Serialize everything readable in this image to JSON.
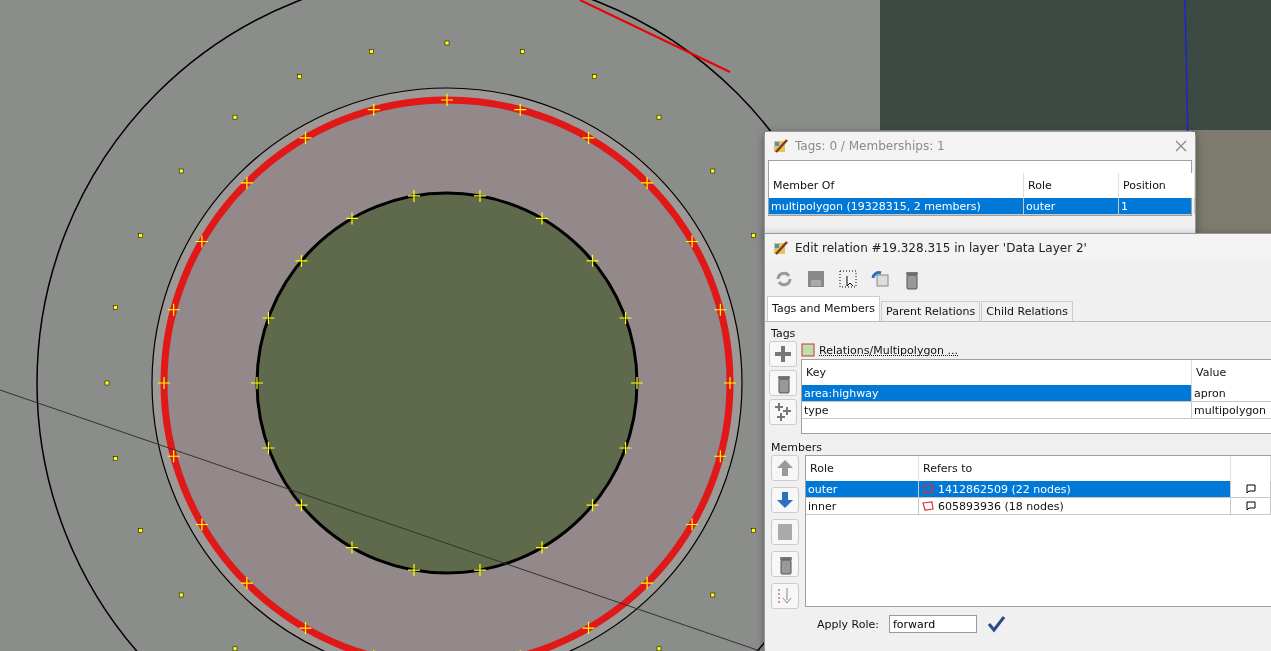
{
  "tags_dialog": {
    "title": "Tags: 0 / Memberships: 1",
    "columns": [
      "Member Of",
      "Role",
      "Position"
    ],
    "rows": [
      {
        "cells": [
          "multipolygon (19328315, 2 members)",
          "outer",
          "1"
        ],
        "selected": true
      }
    ]
  },
  "relation_editor": {
    "title": "Edit relation #19.328.315 in layer 'Data Layer 2'",
    "tabs": [
      {
        "label": "Tags and Members",
        "selected": true
      },
      {
        "label": "Parent Relations",
        "selected": false
      },
      {
        "label": "Child Relations",
        "selected": false
      }
    ],
    "tags_label": "Tags",
    "preset_link": "Relations/Multipolygon ...",
    "tag_columns": [
      "Key",
      "Value"
    ],
    "tags": [
      {
        "key": "area:highway",
        "value": "apron",
        "selected": true
      },
      {
        "key": "type",
        "value": "multipolygon",
        "selected": false
      }
    ],
    "members_label": "Members",
    "member_columns": [
      "Role",
      "Refers to"
    ],
    "members": [
      {
        "role": "outer",
        "refers_to": "1412862509 (22 nodes)",
        "selected": true
      },
      {
        "role": "inner",
        "refers_to": "605893936 (18 nodes)",
        "selected": false
      }
    ],
    "apply_role": {
      "label": "Apply Role:",
      "value": "forward"
    }
  }
}
